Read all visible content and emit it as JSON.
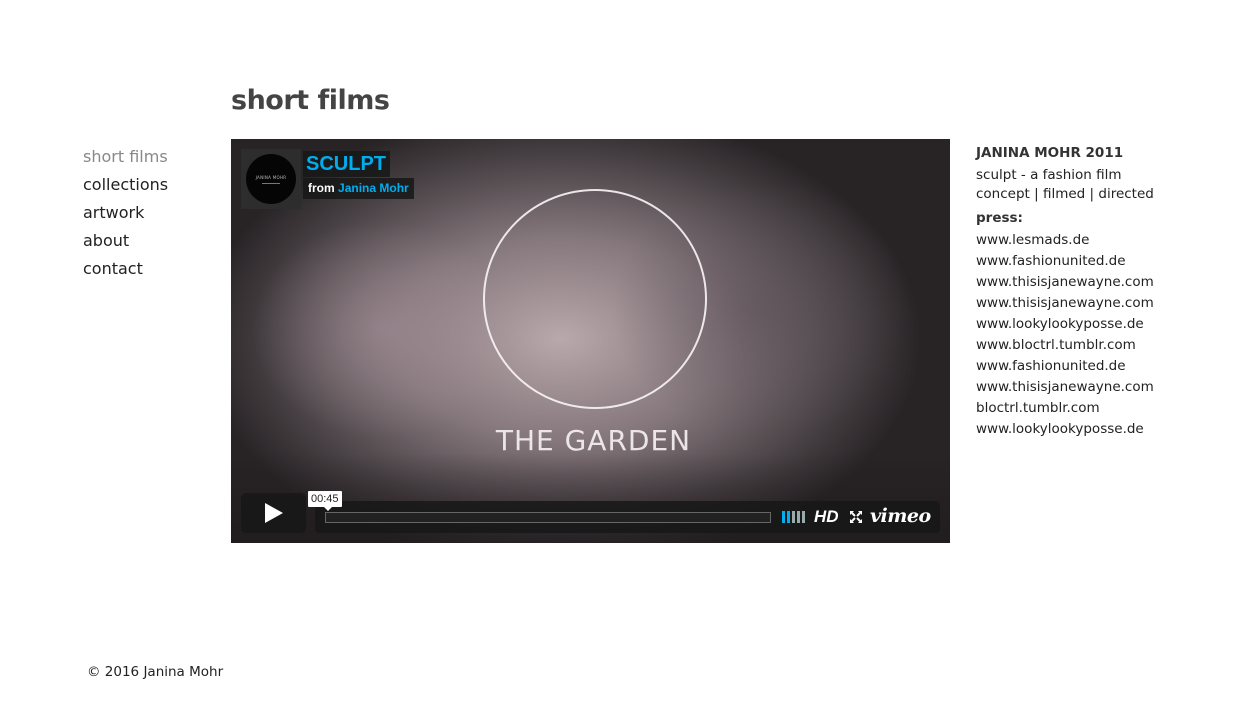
{
  "page": {
    "title": "short films",
    "footer": "© 2016 Janina Mohr"
  },
  "nav": {
    "items": [
      {
        "label": "short films",
        "active": true
      },
      {
        "label": "collections",
        "active": false
      },
      {
        "label": "artwork",
        "active": false
      },
      {
        "label": "about",
        "active": false
      },
      {
        "label": "contact",
        "active": false
      }
    ]
  },
  "player": {
    "title": "SCULPT",
    "byline_prefix": "from",
    "author": "Janina Mohr",
    "avatar_text": "JANINA MOHR",
    "frame_text": "THE GARDEN",
    "time_tooltip": "00:45",
    "hd_label": "HD",
    "brand": "vimeo",
    "accent_color": "#00adef",
    "icons": {
      "play": "play-icon",
      "volume": "volume-icon",
      "fullscreen": "fullscreen-icon"
    }
  },
  "info": {
    "credit_heading": "JANINA MOHR 2011",
    "description": "sculpt - a fashion film",
    "roles": "concept | filmed | directed",
    "press_heading": "press:",
    "press_links": [
      "www.lesmads.de",
      "www.fashionunited.de",
      "www.thisisjanewayne.com",
      "www.thisisjanewayne.com",
      "www.lookylookyposse.de",
      "www.bloctrl.tumblr.com",
      "www.fashionunited.de",
      "www.thisisjanewayne.com",
      "bloctrl.tumblr.com",
      "www.lookylookyposse.de"
    ]
  }
}
